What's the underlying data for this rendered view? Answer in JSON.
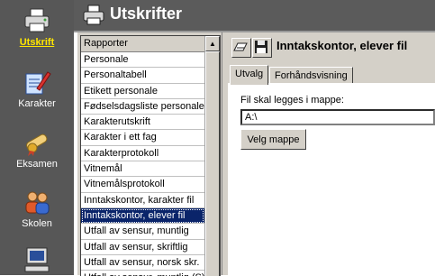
{
  "app": {
    "title": "Utskrifter"
  },
  "sidebar": {
    "items": [
      {
        "label": "Utskrift",
        "icon": "printer-icon",
        "active": true
      },
      {
        "label": "Karakter",
        "icon": "pencil-paper-icon"
      },
      {
        "label": "Eksamen",
        "icon": "diploma-icon"
      },
      {
        "label": "Skolen",
        "icon": "people-icon"
      },
      {
        "label": "",
        "icon": "computer-icon"
      }
    ]
  },
  "reports": {
    "header": "Rapporter",
    "items": [
      "Personale",
      "Personaltabell",
      "Etikett personale",
      "Fødselsdagsliste personale",
      "Karakterutskrift",
      "Karakter i ett fag",
      "Karakterprotokoll",
      "Vitnemål",
      "Vitnemålsprotokoll",
      "Inntakskontor, karakter fil",
      "Inntakskontor, elever fil",
      "Utfall av sensur, muntlig",
      "Utfall av sensur, skriftlig",
      "Utfall av sensur, norsk skr.",
      "Utfall av sensur, muntlig (S)"
    ],
    "selected": "Inntakskontor, elever fil"
  },
  "main": {
    "report_title": "Inntakskontor, elever fil",
    "tabs": [
      "Utvalg",
      "Forhåndsvisning"
    ],
    "active_tab": "Utvalg",
    "field_label": "Fil skal legges i mappe:",
    "field_value": "A:\\",
    "choose_button": "Velg mappe"
  }
}
